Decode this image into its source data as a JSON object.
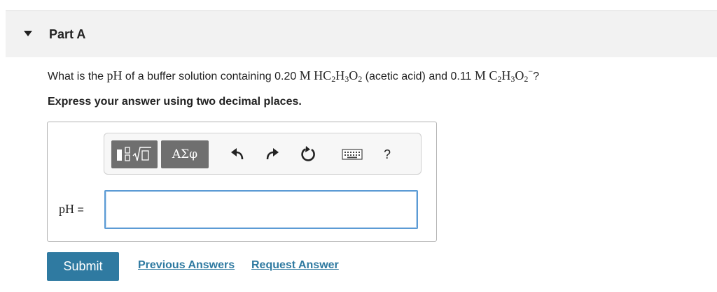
{
  "part": {
    "title": "Part A"
  },
  "question": {
    "prefix": "What is the ",
    "ph_symbol": "pH",
    "middle1": " of a buffer solution containing 0.20 ",
    "unit1": "M",
    "acid": "HC2H3O2",
    "acid_desc": " (acetic acid) and 0.11 ",
    "unit2": "M",
    "base": "C2H3O2−",
    "suffix": "?"
  },
  "instruction": "Express your answer using two decimal places.",
  "toolbar": {
    "templates_icon": "templates-icon",
    "greek_label": "ΑΣφ",
    "undo_icon": "undo-icon",
    "redo_icon": "redo-icon",
    "reset_icon": "reset-icon",
    "keyboard_icon": "keyboard-icon",
    "help_label": "?"
  },
  "answer": {
    "label_symbol": "pH",
    "label_eq": " =",
    "value": ""
  },
  "actions": {
    "submit_label": "Submit",
    "previous_answers_label": "Previous Answers",
    "request_answer_label": "Request Answer"
  },
  "colors": {
    "accent": "#2f7aa1",
    "input_focus": "#5b9bd5",
    "header_bg": "#f2f2f2",
    "toolbar_dark": "#6f6f6f"
  }
}
